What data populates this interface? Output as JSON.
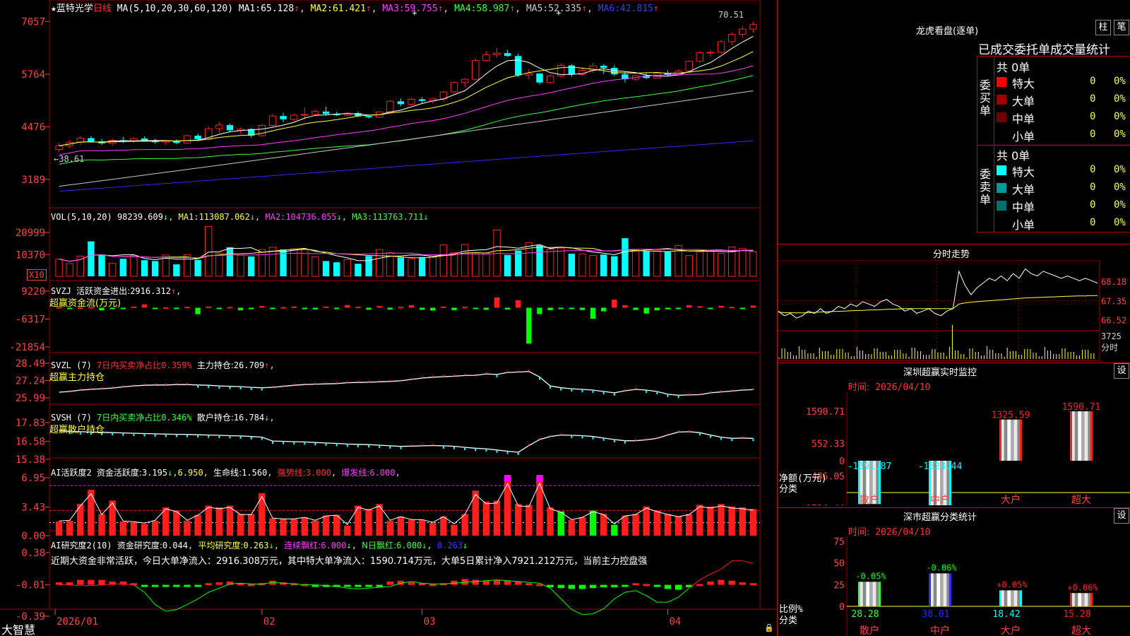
{
  "colors": {
    "up": "#ff1e1e",
    "down": "#00ffff",
    "ma1": "#ffffff",
    "ma2": "#ffff3c",
    "ma3": "#ff3cff",
    "ma4": "#3cff3c",
    "ma5": "#c8c8c8",
    "ma6": "#2a2aff",
    "grid": "#9a0000",
    "axis": "#ff4040",
    "green": "#00ff00",
    "magenta": "#ff00ff"
  },
  "app": {
    "title": "大智慧",
    "lock_icon": "lock-icon"
  },
  "kline": {
    "stock_name": "蓝特光学",
    "period": "日线",
    "ma_params": "MA(5,10,20,30,60,120)",
    "ma": [
      {
        "label": "MA1:",
        "value": "65.128"
      },
      {
        "label": "MA2:",
        "value": "61.421"
      },
      {
        "label": "MA3:",
        "value": "59.755"
      },
      {
        "label": "MA4:",
        "value": "58.987"
      },
      {
        "label": "MA5:",
        "value": "52.335"
      },
      {
        "label": "MA6:",
        "value": "42.815"
      }
    ],
    "y_ticks": [
      "7057",
      "5764",
      "4476",
      "3189"
    ],
    "high_label": "70.51",
    "low_label": "38.61",
    "ohlc": [
      [
        39.2,
        40.8,
        38.6,
        40.1
      ],
      [
        40.1,
        41.5,
        39.5,
        41.0
      ],
      [
        41.0,
        42.6,
        40.4,
        42.0
      ],
      [
        42.0,
        42.5,
        40.9,
        41.2
      ],
      [
        41.2,
        41.8,
        40.3,
        40.7
      ],
      [
        40.7,
        41.9,
        40.1,
        41.5
      ],
      [
        41.5,
        42.3,
        40.8,
        41.3
      ],
      [
        41.3,
        42.2,
        40.9,
        41.9
      ],
      [
        41.9,
        42.4,
        41.1,
        41.4
      ],
      [
        41.4,
        41.9,
        40.6,
        41.0
      ],
      [
        41.0,
        41.6,
        40.4,
        41.3
      ],
      [
        41.3,
        41.7,
        40.5,
        40.8
      ],
      [
        40.8,
        42.9,
        40.7,
        42.6
      ],
      [
        42.6,
        43.1,
        41.2,
        41.7
      ],
      [
        41.7,
        44.8,
        41.5,
        44.3
      ],
      [
        44.3,
        45.9,
        43.2,
        45.2
      ],
      [
        45.2,
        45.6,
        43.4,
        43.9
      ],
      [
        43.9,
        44.6,
        43.0,
        44.2
      ],
      [
        44.2,
        44.5,
        42.1,
        42.6
      ],
      [
        42.6,
        45.5,
        42.3,
        45.1
      ],
      [
        45.1,
        47.9,
        44.8,
        47.4
      ],
      [
        47.4,
        48.2,
        45.9,
        46.6
      ],
      [
        46.6,
        48.0,
        46.1,
        47.6
      ],
      [
        47.6,
        49.5,
        46.6,
        47.8
      ],
      [
        47.8,
        48.9,
        47.4,
        48.5
      ],
      [
        48.5,
        49.7,
        47.5,
        47.9
      ],
      [
        47.9,
        48.4,
        47.4,
        47.6
      ],
      [
        47.6,
        48.3,
        47.2,
        48.1
      ],
      [
        48.1,
        48.5,
        47.1,
        47.4
      ],
      [
        47.4,
        47.7,
        46.8,
        47.1
      ],
      [
        47.1,
        48.6,
        46.9,
        48.4
      ],
      [
        48.4,
        51.3,
        48.0,
        51.0
      ],
      [
        51.0,
        51.7,
        49.8,
        50.3
      ],
      [
        50.3,
        51.8,
        50.0,
        51.5
      ],
      [
        51.5,
        52.0,
        50.5,
        51.1
      ],
      [
        51.1,
        51.8,
        50.5,
        51.6
      ],
      [
        51.6,
        53.6,
        50.9,
        53.3
      ],
      [
        53.3,
        55.9,
        53.0,
        55.6
      ],
      [
        55.6,
        56.7,
        54.5,
        56.4
      ],
      [
        56.4,
        61.5,
        56.0,
        61.0
      ],
      [
        61.0,
        63.2,
        60.8,
        62.4
      ],
      [
        62.4,
        64.1,
        61.7,
        62.8
      ],
      [
        62.8,
        63.6,
        61.9,
        62.1
      ],
      [
        62.1,
        62.7,
        57.0,
        57.4
      ],
      [
        57.4,
        58.9,
        56.3,
        57.8
      ],
      [
        57.8,
        57.9,
        55.1,
        55.6
      ],
      [
        55.6,
        57.6,
        55.3,
        57.2
      ],
      [
        57.2,
        60.3,
        56.9,
        59.8
      ],
      [
        59.8,
        60.1,
        57.0,
        57.6
      ],
      [
        57.6,
        59.1,
        57.3,
        58.6
      ],
      [
        58.6,
        60.4,
        58.0,
        59.7
      ],
      [
        59.7,
        60.1,
        57.7,
        59.2
      ],
      [
        59.2,
        59.9,
        57.2,
        57.6
      ],
      [
        57.6,
        58.2,
        55.6,
        56.4
      ],
      [
        56.4,
        57.6,
        56.0,
        57.3
      ],
      [
        57.3,
        58.1,
        56.4,
        56.7
      ],
      [
        56.7,
        58.2,
        56.6,
        57.9
      ],
      [
        57.9,
        58.6,
        57.2,
        57.4
      ],
      [
        57.4,
        58.8,
        57.2,
        58.4
      ],
      [
        58.4,
        61.0,
        58.1,
        60.8
      ],
      [
        60.8,
        63.4,
        60.4,
        62.9
      ],
      [
        62.9,
        63.6,
        61.9,
        63.0
      ],
      [
        63.0,
        66.1,
        62.7,
        65.6
      ],
      [
        65.6,
        67.9,
        64.7,
        67.4
      ],
      [
        67.4,
        69.5,
        66.5,
        68.7
      ],
      [
        68.7,
        70.5,
        67.8,
        69.8
      ]
    ]
  },
  "vol": {
    "header": "VOL(5,10,20)",
    "value": "98239.609",
    "ma1_label": "MA1:",
    "ma1": "113087.062",
    "ma2_label": "MA2:",
    "ma2": "104736.055",
    "ma3_label": "MA3:",
    "ma3": "113763.711",
    "y_ticks": [
      "20999",
      "10370"
    ],
    "unit": "X10",
    "values": [
      8200,
      6100,
      9600,
      16700,
      10400,
      6300,
      8400,
      9900,
      7700,
      7300,
      10200,
      5700,
      10300,
      7800,
      23800,
      11100,
      13900,
      10100,
      9500,
      12800,
      13900,
      12800,
      13100,
      12700,
      9300,
      7300,
      6700,
      8000,
      6000,
      9700,
      12800,
      11300,
      9000,
      8400,
      9200,
      9700,
      15000,
      11300,
      15200,
      11200,
      11100,
      22200,
      10200,
      12300,
      16100,
      14800,
      12900,
      13500,
      10800,
      10700,
      10000,
      10400,
      9600,
      18200,
      12600,
      11900,
      12200,
      11700,
      14700,
      9900,
      11700,
      12000,
      11000,
      14000,
      13200,
      11800
    ]
  },
  "svzj": {
    "header": "SVZJ",
    "label": "活跃资金进出:",
    "value": "2916.312",
    "subtitle": "超赢资金流(万元)",
    "y_ticks": [
      "9220",
      "-6317",
      "-21854"
    ],
    "values": [
      320,
      -340,
      210,
      380,
      -1480,
      -570,
      -280,
      620,
      1860,
      -620,
      210,
      -270,
      490,
      -3640,
      610,
      -540,
      390,
      -1430,
      -320,
      960,
      -510,
      310,
      680,
      -280,
      -970,
      650,
      -380,
      1470,
      530,
      -1090,
      970,
      -1020,
      440,
      1440,
      -1150,
      -1600,
      640,
      -1370,
      470,
      -510,
      -1150,
      5700,
      -980,
      4180,
      -19990,
      -3530,
      -1390,
      -610,
      -690,
      -1290,
      -6140,
      -2050,
      4560,
      1440,
      -1240,
      -3230,
      -1460,
      -930,
      -690,
      1450,
      780,
      -620,
      1060,
      470,
      -760,
      1190
    ]
  },
  "svzl": {
    "header": "SVZL (7)",
    "desc": "7日内买卖净占比0.359%",
    "label": "主力持仓:",
    "value": "26.709",
    "subtitle": "超赢主力持仓",
    "y_ticks": [
      "28.49",
      "27.24",
      "25.99"
    ],
    "values": [
      26.4,
      26.45,
      26.55,
      26.6,
      26.65,
      26.7,
      26.78,
      26.85,
      26.9,
      26.92,
      26.92,
      26.95,
      26.95,
      26.92,
      26.9,
      26.85,
      26.82,
      26.8,
      26.75,
      26.72,
      26.75,
      26.82,
      26.9,
      26.95,
      26.98,
      27.0,
      27.02,
      27.08,
      27.1,
      27.12,
      27.15,
      27.18,
      27.22,
      27.32,
      27.42,
      27.48,
      27.52,
      27.55,
      27.6,
      27.62,
      27.72,
      27.68,
      27.82,
      27.85,
      27.9,
      27.5,
      26.85,
      26.72,
      26.65,
      26.6,
      26.55,
      26.45,
      26.35,
      26.5,
      26.6,
      26.55,
      26.45,
      26.25,
      26.18,
      26.2,
      26.22,
      26.35,
      26.42,
      26.48,
      26.55,
      26.58
    ]
  },
  "svsh": {
    "header": "SVSH (7)",
    "desc": "7日内买卖净占比0.346%",
    "label": "散户持仓:",
    "value": "16.784",
    "subtitle": "超赢散户持仓",
    "y_ticks": [
      "17.83",
      "16.58",
      "15.38"
    ],
    "values": [
      17.3,
      17.25,
      17.22,
      17.2,
      17.18,
      17.16,
      17.14,
      17.12,
      17.1,
      17.08,
      17.06,
      17.05,
      17.04,
      17.02,
      17.0,
      16.98,
      16.96,
      16.94,
      16.9,
      16.86,
      16.6,
      16.58,
      16.56,
      16.54,
      16.5,
      16.47,
      16.44,
      16.4,
      16.38,
      16.36,
      16.32,
      16.28,
      16.24,
      16.26,
      16.28,
      16.3,
      16.28,
      16.25,
      16.18,
      16.12,
      16.08,
      16.0,
      15.92,
      15.85,
      16.3,
      16.7,
      16.9,
      17.0,
      16.98,
      16.96,
      16.9,
      16.8,
      16.7,
      16.62,
      16.62,
      16.68,
      16.78,
      17.0,
      17.2,
      17.22,
      17.16,
      17.0,
      16.86,
      16.78,
      16.8,
      16.78
    ]
  },
  "ai_active": {
    "header": "AI活跃度2",
    "label": "资金活跃度:",
    "value": "3.195",
    "value2": "6.950",
    "life_label": "生命线:",
    "life_value": "1.560",
    "strong_label": "强势线:",
    "strong_value": "3.000",
    "burst_label": "爆发线:",
    "burst_value": "6.000",
    "y_ticks": [
      "6.95",
      "3.43",
      "0.00"
    ],
    "values": [
      1.7,
      1.8,
      3.8,
      5.5,
      2.6,
      4.2,
      1.7,
      1.6,
      1.4,
      1.8,
      3.4,
      3.0,
      1.8,
      2.5,
      3.6,
      3.4,
      3.6,
      2.6,
      2.6,
      5.1,
      2.1,
      2.0,
      2.0,
      2.2,
      1.8,
      2.4,
      2.5,
      1.2,
      3.6,
      3.2,
      3.8,
      1.8,
      2.3,
      1.9,
      1.9,
      1.5,
      2.3,
      1.3,
      2.6,
      5.4,
      4.1,
      4.2,
      6.9,
      3.8,
      3.7,
      6.95,
      3.4,
      2.9,
      1.9,
      2.2,
      3.0,
      2.6,
      1.3,
      2.4,
      2.6,
      3.5,
      3.0,
      2.6,
      2.3,
      2.6,
      3.7,
      3.5,
      3.8,
      3.5,
      3.4,
      3.2
    ],
    "magenta_idx": [
      42,
      45
    ]
  },
  "ai_research": {
    "header": "AI研究度2(10)",
    "label": "资金研究度:",
    "value": "0.044",
    "avg_label": "平均研究度:",
    "avg_value": "0.263",
    "red_label": "连续飘红:",
    "red_value": "6.000",
    "n_label": "N日飘红:",
    "n_value": "6.000",
    "extra_value": "0.263",
    "commentary": "近期大资金非常活跃，今日大单净流入：2916.308万元，其中特大单净流入：1590.714万元，大单5日累计净入7921.212万元，当前主力控盘强",
    "y_ticks": [
      "0.38",
      "-0.01",
      "-0.39"
    ],
    "values": [
      0.03,
      0.03,
      0.06,
      0.06,
      0.06,
      0.04,
      0.04,
      0.02,
      -0.01,
      -0.02,
      -0.02,
      -0.02,
      -0.02,
      -0.01,
      0.02,
      0.03,
      0.04,
      0.02,
      0.01,
      0.02,
      0.05,
      0.03,
      0.02,
      0.01,
      -0.01,
      -0.02,
      -0.02,
      -0.01,
      -0.02,
      -0.02,
      -0.01,
      0.04,
      0.05,
      0.03,
      0.02,
      0.01,
      0.02,
      0.05,
      0.07,
      0.06,
      0.05,
      0.06,
      0.05,
      0.04,
      0.02,
      0.01,
      -0.03,
      -0.04,
      -0.05,
      -0.05,
      -0.04,
      -0.03,
      -0.03,
      -0.01,
      0.02,
      0.01,
      -0.02,
      -0.05,
      -0.06,
      -0.03,
      0.01,
      0.04,
      0.06,
      0.05,
      0.03,
      0.02
    ],
    "line": [
      -0.01,
      -0.01,
      -0.02,
      -0.02,
      -0.01,
      0.0,
      0.0,
      -0.01,
      -0.1,
      -0.25,
      -0.33,
      -0.31,
      -0.25,
      -0.18,
      -0.1,
      -0.05,
      0.0,
      0.01,
      0.0,
      0.0,
      0.02,
      0.01,
      0.0,
      -0.01,
      -0.01,
      -0.02,
      -0.03,
      -0.05,
      -0.06,
      -0.05,
      -0.04,
      -0.03,
      0.01,
      0.03,
      0.01,
      0.0,
      0.0,
      0.01,
      0.02,
      0.03,
      0.04,
      0.05,
      0.04,
      0.03,
      0.02,
      0.01,
      -0.05,
      -0.18,
      -0.31,
      -0.37,
      -0.36,
      -0.3,
      -0.18,
      -0.1,
      -0.08,
      -0.14,
      -0.22,
      -0.22,
      -0.16,
      -0.05,
      0.05,
      0.12,
      0.18,
      0.28,
      0.28,
      0.25
    ]
  },
  "x_axis": [
    "2026/01",
    "02",
    "03",
    "04"
  ],
  "dragon": {
    "title": "龙虎看盘(逐单)",
    "btn1": "柱",
    "btn2": "笔",
    "header": "已成交委托单成交量统计",
    "buy_label": "委买单",
    "sell_label": "委卖单",
    "buy_total": "共 0单",
    "sell_total": "共 0单",
    "buy_rows": [
      {
        "name": "特大",
        "val": "0",
        "pct": "0%",
        "color": "#ff0000"
      },
      {
        "name": "大单",
        "val": "0",
        "pct": "0%",
        "color": "#a00000"
      },
      {
        "name": "中单",
        "val": "0",
        "pct": "0%",
        "color": "#700000"
      },
      {
        "name": "小单",
        "val": "0",
        "pct": "0%",
        "color": "#000000"
      }
    ],
    "sell_rows": [
      {
        "name": "特大",
        "val": "0",
        "pct": "0%",
        "color": "#00ffff"
      },
      {
        "name": "大单",
        "val": "0",
        "pct": "0%",
        "color": "#009a9a"
      },
      {
        "name": "中单",
        "val": "0",
        "pct": "0%",
        "color": "#007070"
      },
      {
        "name": "小单",
        "val": "0",
        "pct": "0%",
        "color": "#000000"
      }
    ]
  },
  "minute": {
    "title": "分时走势",
    "y_ticks": [
      "68.18",
      "67.35",
      "66.52"
    ],
    "vol_tick": "3725",
    "vol_unit": "分时",
    "price": [
      66.9,
      66.7,
      66.8,
      66.6,
      66.7,
      66.9,
      66.8,
      67.0,
      66.8,
      66.9,
      67.1,
      67.0,
      67.2,
      67.1,
      67.3,
      67.2,
      67.1,
      67.3,
      67.4,
      67.2,
      67.1,
      66.9,
      67.0,
      66.8,
      66.9,
      67.0,
      66.8,
      66.7,
      66.9,
      67.0,
      68.6,
      68.0,
      67.6,
      67.9,
      68.1,
      68.3,
      68.2,
      68.4,
      68.2,
      68.5,
      68.3,
      68.7,
      68.5,
      68.4,
      68.6,
      68.5,
      68.4,
      68.3,
      68.4,
      68.3,
      68.2,
      68.3,
      68.2,
      68.1
    ],
    "avg": [
      66.85,
      66.83,
      66.83,
      66.82,
      66.82,
      66.83,
      66.84,
      66.86,
      66.87,
      66.88,
      66.89,
      66.9,
      66.91,
      66.92,
      66.93,
      66.94,
      66.95,
      66.96,
      66.97,
      66.98,
      66.99,
      67.0,
      67.0,
      67.0,
      67.0,
      67.0,
      67.0,
      67.0,
      67.0,
      67.0,
      67.2,
      67.25,
      67.28,
      67.3,
      67.32,
      67.34,
      67.36,
      67.38,
      67.4,
      67.42,
      67.44,
      67.46,
      67.47,
      67.48,
      67.49,
      67.5,
      67.51,
      67.52,
      67.53,
      67.54,
      67.55,
      67.55,
      67.56,
      67.56
    ]
  },
  "sz_monitor": {
    "title": "深圳超赢实时监控",
    "btn": "设",
    "time_label": "时间:",
    "time": "2026/04/10",
    "y_ticks": [
      "1590.71",
      "552.33",
      "0",
      "-486.05",
      "-1524.44"
    ],
    "ylabel": "净额(万元)",
    "xlabel": "分类",
    "categories": [
      "散户",
      "中户",
      "大户",
      "超大"
    ],
    "values": [
      -1391.87,
      -1524.44,
      1325.59,
      1590.71
    ],
    "labels": [
      "-1391.87",
      "-1524.44",
      "1325.59",
      "1590.71"
    ],
    "ylim": [
      -1524.44,
      1590.71
    ]
  },
  "sz_class": {
    "title": "深市超赢分类统计",
    "btn": "设",
    "time_label": "时间:",
    "time": "2026/04/10",
    "y_ticks": [
      "75",
      "50",
      "25",
      "0"
    ],
    "ylabel": "比例%",
    "xlabel": "分类",
    "categories": [
      "散户",
      "中户",
      "大户",
      "超大"
    ],
    "values": [
      28.28,
      38.01,
      18.42,
      15.28
    ],
    "value_labels": [
      "28.28",
      "38.01",
      "18.42",
      "15.28"
    ],
    "changes": [
      "-0.05%",
      "-0.06%",
      "+0.05%",
      "+0.06%"
    ],
    "colors": [
      "#3cff3c",
      "#2a2aff",
      "#00ffff",
      "#ff1e1e"
    ],
    "ylim": [
      0,
      75
    ]
  },
  "chart_data": [
    {
      "type": "bar",
      "title": "深圳超赢实时监控",
      "categories": [
        "散户",
        "中户",
        "大户",
        "超大"
      ],
      "values": [
        -1391.87,
        -1524.44,
        1325.59,
        1590.71
      ],
      "ylabel": "净额(万元)",
      "xlabel": "分类",
      "ylim": [
        -1524.44,
        1590.71
      ]
    },
    {
      "type": "bar",
      "title": "深市超赢分类统计",
      "categories": [
        "散户",
        "中户",
        "大户",
        "超大"
      ],
      "values": [
        28.28,
        38.01,
        18.42,
        15.28
      ],
      "ylabel": "比例%",
      "xlabel": "分类",
      "ylim": [
        0,
        75
      ]
    }
  ]
}
